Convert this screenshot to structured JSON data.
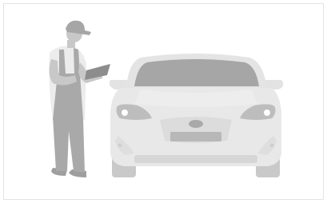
{
  "illustration": {
    "subject": "mechanic-inspecting-car-icon",
    "colors": {
      "frame_border": "#dfe4ea",
      "background": "#ffffff",
      "car_body": "#e6e6e6",
      "car_dark": "#bdbdbd",
      "windshield": "#a6a6a6",
      "person_clothing": "#a9a9a9",
      "person_shirt": "#ececec",
      "person_skin": "#c8c8c8",
      "tablet": "#8d8d8d"
    }
  }
}
